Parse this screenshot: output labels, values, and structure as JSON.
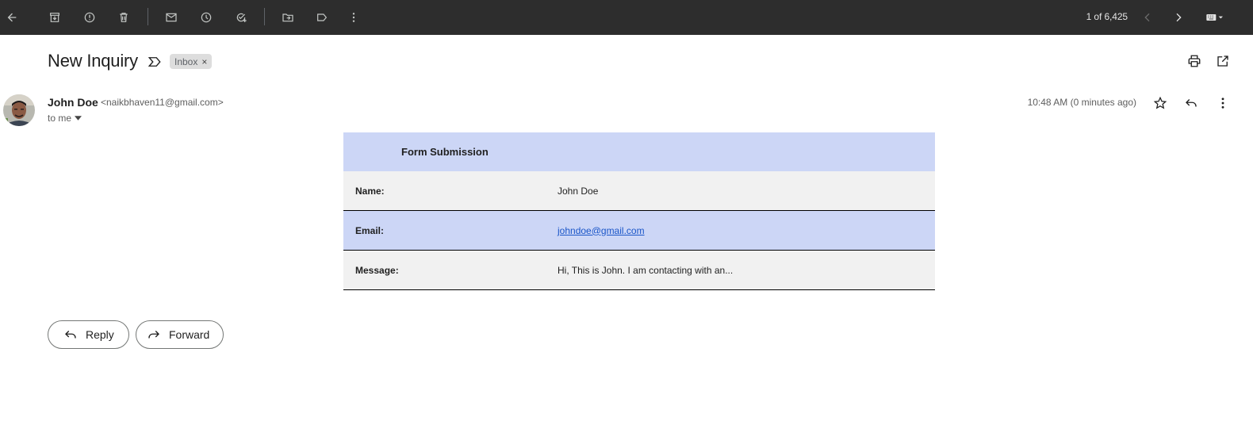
{
  "toolbar": {
    "back_icon": "arrow-back-icon",
    "archive_icon": "archive-icon",
    "spam_icon": "report-spam-icon",
    "delete_icon": "delete-icon",
    "mark_unread_icon": "mail-icon",
    "snooze_icon": "clock-icon",
    "add_task_icon": "add-task-icon",
    "move_icon": "move-to-folder-icon",
    "label_icon": "label-icon",
    "more_icon": "more-vert-icon",
    "counter": "1 of 6,425",
    "input_tools_icon": "keyboard-icon"
  },
  "email": {
    "subject": "New Inquiry",
    "label": "Inbox",
    "label_remove": "×",
    "sender_name": "John Doe",
    "sender_email": "<naikbhaven11@gmail.com>",
    "recipient": "to me",
    "timestamp": "10:48 AM (0 minutes ago)"
  },
  "form": {
    "title": "Form Submission",
    "rows": [
      {
        "label": "Name:",
        "value": "John Doe"
      },
      {
        "label": "Email:",
        "value": "johndoe@gmail.com"
      },
      {
        "label": "Message:",
        "value": "Hi, This is John. I am contacting with an..."
      }
    ]
  },
  "actions": {
    "reply": "Reply",
    "forward": "Forward"
  },
  "colors": {
    "toolbar_bg": "#2d2d2d",
    "form_header_bg": "#ccd6f6",
    "form_row_gray": "#f1f1f1",
    "link": "#1a55c8"
  }
}
